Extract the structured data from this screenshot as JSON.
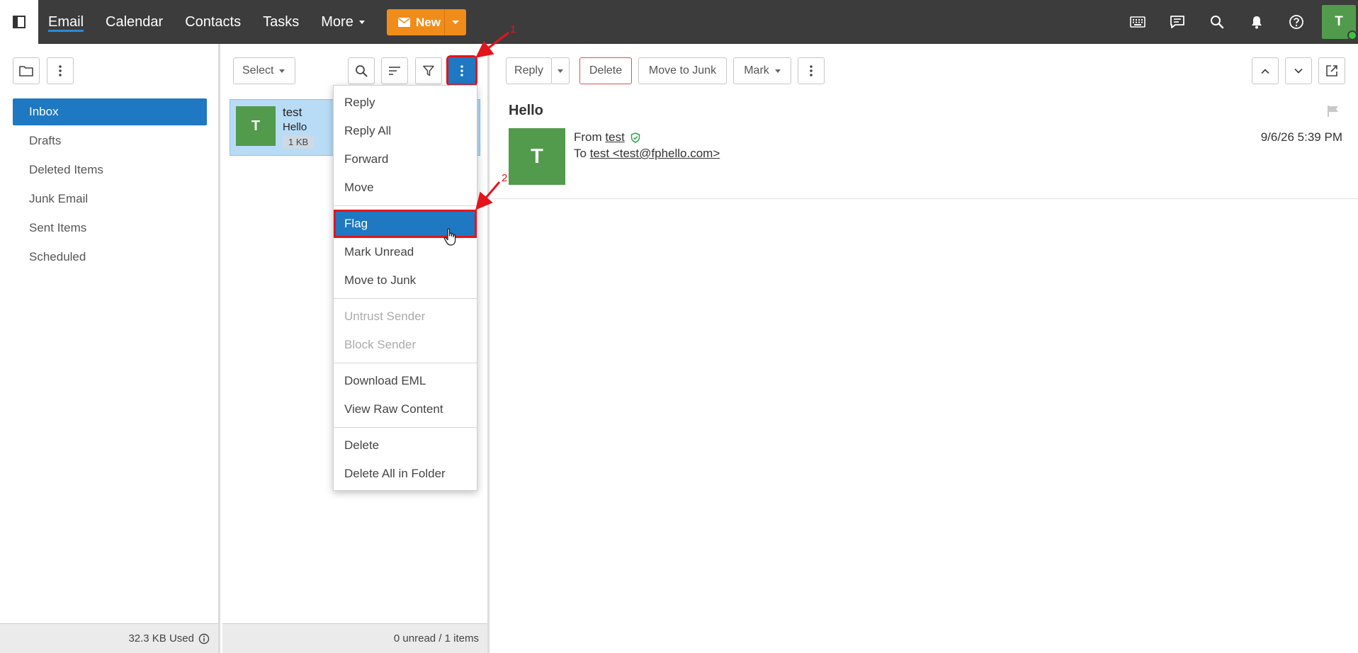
{
  "topbar": {
    "nav": [
      {
        "label": "Email"
      },
      {
        "label": "Calendar"
      },
      {
        "label": "Contacts"
      },
      {
        "label": "Tasks"
      },
      {
        "label": "More"
      }
    ],
    "new_label": "New",
    "avatar_initial": "T"
  },
  "folders": {
    "items": [
      {
        "label": "Inbox"
      },
      {
        "label": "Drafts"
      },
      {
        "label": "Deleted Items"
      },
      {
        "label": "Junk Email"
      },
      {
        "label": "Sent Items"
      },
      {
        "label": "Scheduled"
      }
    ],
    "usage": "32.3 KB Used"
  },
  "list": {
    "select_label": "Select",
    "message": {
      "initial": "T",
      "sender": "test",
      "subject": "Hello",
      "size": "1 KB"
    },
    "footer": "0 unread / 1 items"
  },
  "menu": {
    "groups": [
      [
        "Reply",
        "Reply All",
        "Forward",
        "Move"
      ],
      [
        "Flag",
        "Mark Unread",
        "Move to Junk"
      ],
      [
        "Untrust Sender",
        "Block Sender"
      ],
      [
        "Download EML",
        "View Raw Content"
      ],
      [
        "Delete",
        "Delete All in Folder"
      ]
    ]
  },
  "reader": {
    "toolbar": {
      "reply": "Reply",
      "delete": "Delete",
      "junk": "Move to Junk",
      "mark": "Mark"
    },
    "subject": "Hello",
    "initial": "T",
    "from_label": "From",
    "from_name": "test",
    "to_label": "To",
    "to_address": "test <test@fphello.com>",
    "date": "9/6/26 5:39 PM"
  },
  "annotations": {
    "step1": "1",
    "step2": "2"
  },
  "colors": {
    "topbar": "#3c3c3c",
    "accent": "#1e78c2",
    "new_button": "#f08c1a",
    "avatar": "#529a4c",
    "annotation": "#e3141b"
  }
}
